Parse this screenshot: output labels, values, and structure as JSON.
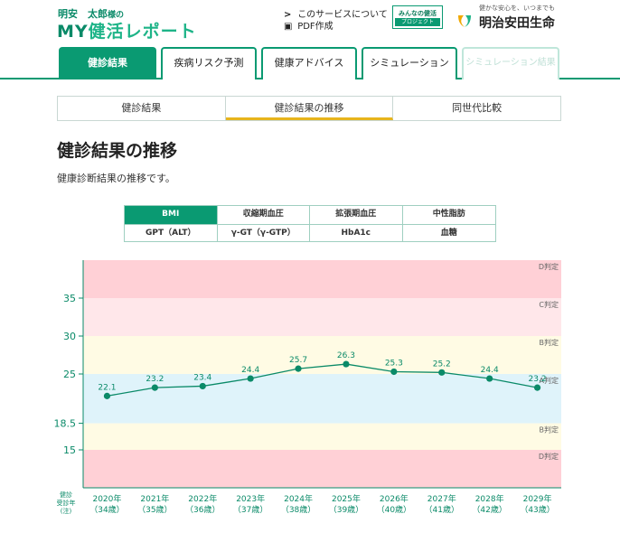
{
  "header": {
    "user_name": "明安　太郎",
    "user_suffix": "様の",
    "brand_my": "MY",
    "brand_rest": "健活レポート",
    "links": [
      {
        "icon": ">",
        "label": "このサービスについて"
      },
      {
        "icon": "▣",
        "label": "PDF作成"
      }
    ],
    "minna_top": "みんなの健活",
    "minna_bottom": "プロジェクト",
    "company_tagline": "健かな安心を、いつまでも",
    "company_name": "明治安田生命"
  },
  "main_tabs": [
    {
      "label": "健診結果",
      "active": true
    },
    {
      "label": "疾病リスク予測"
    },
    {
      "label": "健康アドバイス"
    },
    {
      "label": "シミュレーション"
    },
    {
      "label": "シミュレーション結果",
      "disabled": true
    }
  ],
  "sub_tabs": [
    {
      "label": "健診結果"
    },
    {
      "label": "健診結果の推移",
      "active": true
    },
    {
      "label": "同世代比較"
    }
  ],
  "page_title": "健診結果の推移",
  "page_desc": "健康診断結果の推移です。",
  "metrics": [
    [
      "BMI",
      "収縮期血圧",
      "拡張期血圧",
      "中性脂肪"
    ],
    [
      "GPT（ALT）",
      "γ-GT（γ-GTP）",
      "HbA1c",
      "血糖"
    ]
  ],
  "colors": {
    "accent": "#0a9a72",
    "line": "#0a8a68",
    "band_d": "#ffd0d6",
    "band_c": "#ffe7ea",
    "band_b": "#fffbe4",
    "band_a": "#dff3fa"
  },
  "chart_data": {
    "type": "line",
    "x": [
      "2020年",
      "2021年",
      "2022年",
      "2023年",
      "2024年",
      "2025年",
      "2026年",
      "2027年",
      "2028年",
      "2029年"
    ],
    "x_ages": [
      "（34歳）",
      "（35歳）",
      "（36歳）",
      "（37歳）",
      "（38歳）",
      "（39歳）",
      "（40歳）",
      "（41歳）",
      "（42歳）",
      "（43歳）"
    ],
    "values": [
      22.1,
      23.2,
      23.4,
      24.4,
      25.7,
      26.3,
      25.3,
      25.2,
      24.4,
      23.2
    ],
    "yticks": [
      15,
      18.5,
      25,
      30,
      35
    ],
    "ylim": [
      10,
      40
    ],
    "xlabel_lines": [
      "健診",
      "受診年",
      "(注)"
    ],
    "bands": [
      {
        "from": 35,
        "to": 40,
        "label": "D判定",
        "color": "#ffd0d6"
      },
      {
        "from": 30,
        "to": 35,
        "label": "C判定",
        "color": "#ffe7ea"
      },
      {
        "from": 25,
        "to": 30,
        "label": "B判定",
        "color": "#fffbe4"
      },
      {
        "from": 18.5,
        "to": 25,
        "label": "A判定",
        "color": "#dff3fa"
      },
      {
        "from": 15,
        "to": 18.5,
        "label": "B判定",
        "color": "#fffbe4"
      },
      {
        "from": 10,
        "to": 15,
        "label": "D判定",
        "color": "#ffd0d6"
      }
    ]
  }
}
